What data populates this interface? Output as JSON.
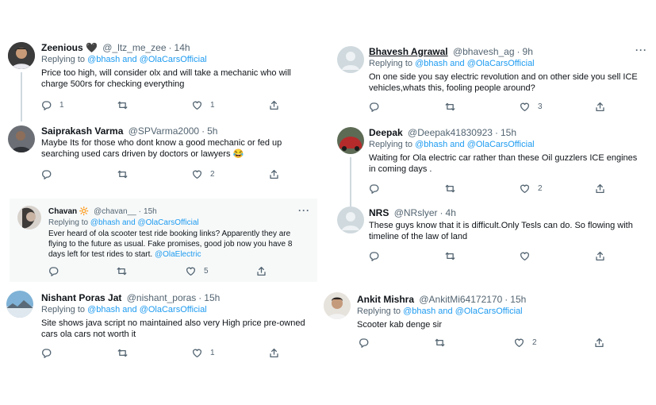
{
  "tweets": {
    "t1": {
      "name": "Zeenious 🖤",
      "handle": "@_ltz_me_zee",
      "time": "14h",
      "reply_prefix": "Replying to ",
      "mentions": "@bhash and @OlaCarsOfficial",
      "text": "Price too high, will consider olx and will take a mechanic who will charge 500rs for checking everything",
      "replies": "1",
      "retweets": "",
      "likes": "1"
    },
    "t2": {
      "name": "Saiprakash Varma",
      "handle": "@SPVarma2000",
      "time": "5h",
      "text": "Maybe Its for those who dont know a good mechanic or fed up searching used cars driven by doctors or lawyers 😂",
      "replies": "",
      "retweets": "",
      "likes": "2"
    },
    "t3": {
      "name": "Chavan 🔆",
      "handle": "@chavan__",
      "time": "15h",
      "reply_prefix": "Replying to ",
      "mentions": "@bhash and @OlaCarsOfficial",
      "text": "Ever heard of ola scooter test ride booking links? Apparently they are flying to the future as usual. Fake promises, good job now you have 8 days left for test rides to start.",
      "text_link": "@OlaElectric",
      "replies": "",
      "retweets": "",
      "likes": "5"
    },
    "t4": {
      "name": "Nishant Poras Jat",
      "handle": "@nishant_poras",
      "time": "15h",
      "reply_prefix": "Replying to ",
      "mentions": "@bhash and @OlaCarsOfficial",
      "text": "Site shows java script no maintained also very High price pre-owned cars ola cars not worth it",
      "replies": "",
      "retweets": "",
      "likes": "1"
    },
    "t5": {
      "name": "Bhavesh Agrawal",
      "handle": "@bhavesh_ag",
      "time": "9h",
      "reply_prefix": "Replying to ",
      "mentions": "@bhash and @OlaCarsOfficial",
      "text": "On one side you say electric revolution and on other side you sell ICE vehicles,whats this, fooling people around?",
      "replies": "",
      "retweets": "",
      "likes": "3"
    },
    "t6": {
      "name": "Deepak",
      "handle": "@Deepak41830923",
      "time": "15h",
      "reply_prefix": "Replying to ",
      "mentions": "@bhash and @OlaCarsOfficial",
      "text": "Waiting for Ola electric car rather than these Oil guzzlers ICE engines in coming days .",
      "replies": "",
      "retweets": "",
      "likes": "2"
    },
    "t7": {
      "name": "NRS",
      "handle": "@NRslyer",
      "time": "4h",
      "text": "These guys know that it is difficult.Only Tesls can do. So flowing with timeline of the law of land",
      "replies": "",
      "retweets": "",
      "likes": ""
    },
    "t8": {
      "name": "Ankit Mishra",
      "handle": "@AnkitMi64172170",
      "time": "15h",
      "reply_prefix": "Replying to ",
      "mentions": "@bhash and @OlaCarsOfficial",
      "text": "Scooter kab denge sir",
      "replies": "",
      "retweets": "",
      "likes": "2"
    }
  },
  "more_label": "···",
  "separator": "·",
  "icons": [
    "reply-icon",
    "retweet-icon",
    "like-icon",
    "share-icon",
    "more-icon",
    "avatar"
  ],
  "colors": {
    "link": "#1d9bf0",
    "secondary": "#536471",
    "thread_line": "#cfd9de",
    "shaded_bg": "#f7f9f9"
  }
}
